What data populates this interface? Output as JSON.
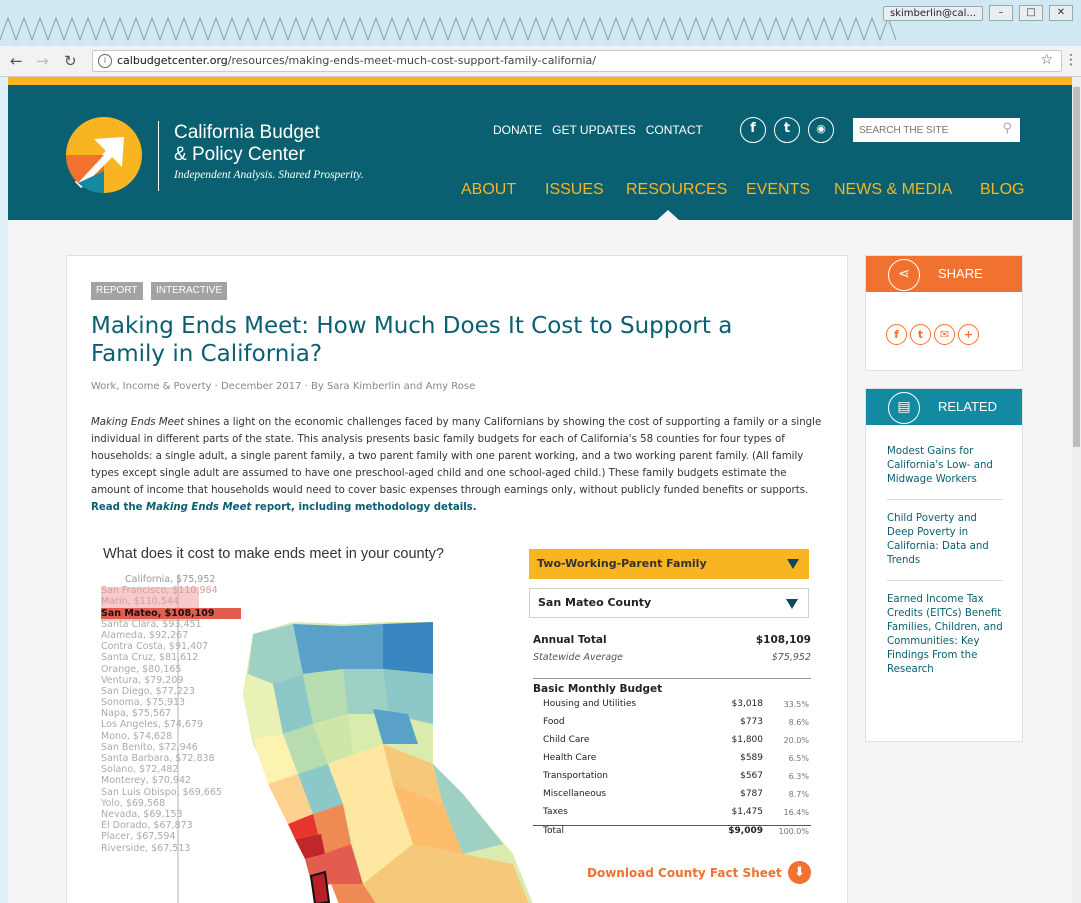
{
  "browser": {
    "user_badge": "skimberlin@cal...",
    "url_host": "calbudgetcenter.org",
    "url_path": "/resources/making-ends-meet-much-cost-support-family-california/"
  },
  "header": {
    "org_name_line1": "California Budget",
    "org_name_line2": "& Policy Center",
    "tagline": "Independent Analysis. Shared Prosperity.",
    "utility_nav": [
      "DONATE",
      "GET UPDATES",
      "CONTACT"
    ],
    "social": [
      "f",
      "t",
      "rss"
    ],
    "search_placeholder": "SEARCH THE SITE",
    "main_nav": [
      "ABOUT",
      "ISSUES",
      "RESOURCES",
      "EVENTS",
      "NEWS & MEDIA",
      "BLOG"
    ],
    "accent": "#f8b421",
    "brand": "#0a6070"
  },
  "article": {
    "tags": [
      "REPORT",
      "INTERACTIVE"
    ],
    "title": "Making Ends Meet: How Much Does It Cost to Support a Family in California?",
    "meta": "Work, Income & Poverty · December 2017 · By Sara Kimberlin and Amy Rose",
    "intro_lead": "Making Ends Meet",
    "intro_body": " shines a light on the economic challenges faced by many Californians by showing the cost of supporting a family or a single individual in different parts of the state. This analysis presents basic family budgets for each of California's 58 counties for four types of households: a single adult, a single parent family, a two parent family with one parent working, and a two working parent family. (All family types except single adult are assumed to have one preschool-aged child and one school-aged child.) These family budgets estimate the amount of income that households would need to cover basic expenses through earnings only, without publicly funded benefits or supports. ",
    "link_prefix": "Read the ",
    "link_italic": "Making Ends Meet",
    "link_suffix": " report, including methodology details."
  },
  "interactive": {
    "map_title": "What does it cost to make ends meet in your county?",
    "statewide_label": "California, $75,952",
    "counties": [
      "San Francisco, $110,984",
      "Marin, $110,544",
      "San Mateo, $108,109",
      "Santa Clara, $93,451",
      "Alameda, $92,267",
      "Contra Costa, $91,407",
      "Santa Cruz, $81,612",
      "Orange, $80,165",
      "Ventura, $79,209",
      "San Diego, $77,223",
      "Sonoma, $75,913",
      "Napa, $75,567",
      "Los Angeles, $74,679",
      "Mono, $74,628",
      "San Benito, $72,946",
      "Santa Barbara, $72,838",
      "Solano, $72,482",
      "Monterey, $70,942",
      "San Luis Obispo, $69,665",
      "Yolo, $69,568",
      "Nevada, $69,153",
      "El Dorado, $67,873",
      "Placer, $67,594",
      "Riverside, $67,513"
    ],
    "selected_county_index": 2,
    "family_type": "Two-Working-Parent Family",
    "county": "San Mateo County",
    "annual_total_label": "Annual Total",
    "annual_total": "$108,109",
    "statewide_avg_label": "Statewide Average",
    "statewide_avg": "$75,952",
    "monthly_label": "Basic Monthly Budget",
    "items": [
      {
        "label": "Housing and Utilities",
        "amount": "$3,018",
        "pct": "33.5%"
      },
      {
        "label": "Food",
        "amount": "$773",
        "pct": "8.6%"
      },
      {
        "label": "Child Care",
        "amount": "$1,800",
        "pct": "20.0%"
      },
      {
        "label": "Health Care",
        "amount": "$589",
        "pct": "6.5%"
      },
      {
        "label": "Transportation",
        "amount": "$567",
        "pct": "6.3%"
      },
      {
        "label": "Miscellaneous",
        "amount": "$787",
        "pct": "8.7%"
      },
      {
        "label": "Taxes",
        "amount": "$1,475",
        "pct": "16.4%"
      }
    ],
    "total": {
      "label": "Total",
      "amount": "$9,009",
      "pct": "100.0%"
    },
    "download_label": "Download County Fact Sheet"
  },
  "sidebar": {
    "share_label": "SHARE",
    "share_icons": [
      "facebook-icon",
      "twitter-icon",
      "email-icon",
      "plus-icon"
    ],
    "related_label": "RELATED",
    "related": [
      "Modest Gains for California's Low- and Midwage Workers",
      "Child Poverty and Deep Poverty in California: Data and Trends",
      "Earned Income Tax Credits (EITCs) Benefit Families, Children, and Communities: Key Findings From the Research"
    ],
    "share_color": "#f07130",
    "related_color": "#138aa2"
  }
}
